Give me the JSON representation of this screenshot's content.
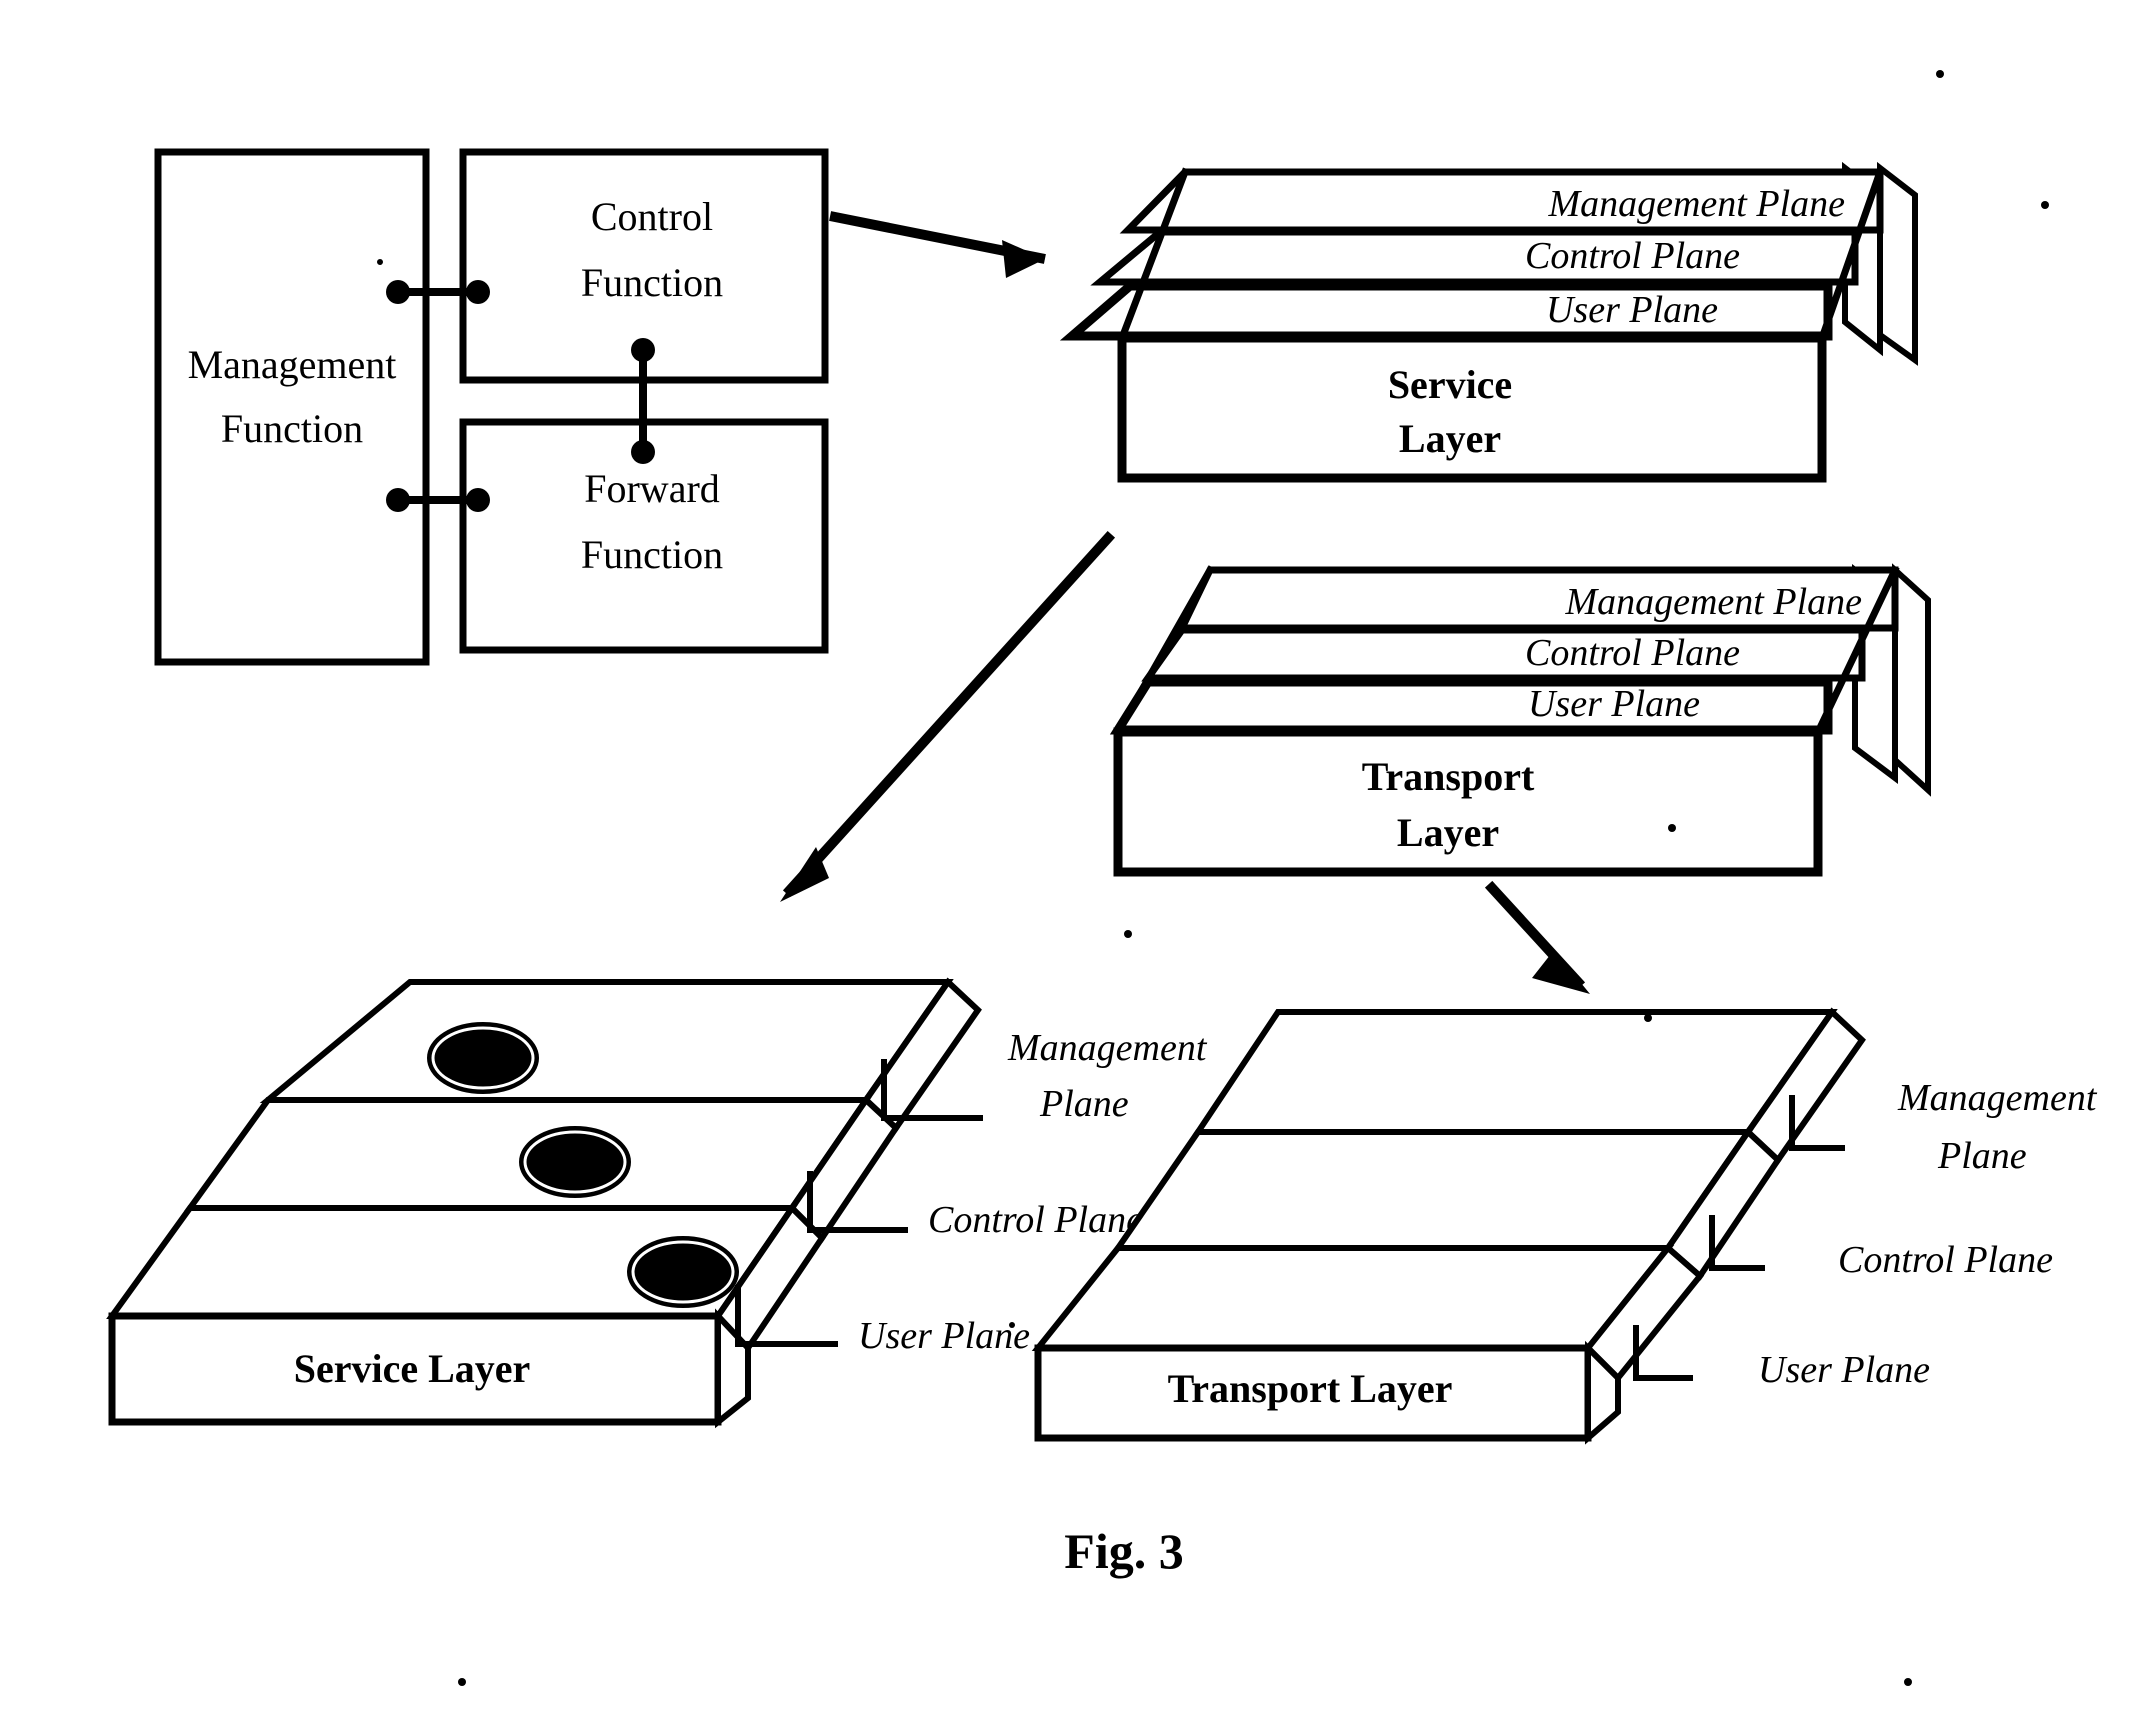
{
  "figure": {
    "caption": "Fig. 3",
    "blocks": {
      "management_function": "Management\nFunction",
      "management_function_line1": "Management",
      "management_function_line2": "Function",
      "control_function_line1": "Control",
      "control_function_line2": "Function",
      "forward_function_line1": "Forward",
      "forward_function_line2": "Function"
    },
    "service_stack": {
      "plane_labels": [
        "Management Plane",
        "Control Plane",
        "User Plane"
      ],
      "layer_label_line1": "Service",
      "layer_label_line2": "Layer"
    },
    "transport_stack": {
      "plane_labels": [
        "Management Plane",
        "Control Plane",
        "User Plane"
      ],
      "layer_label_line1": "Transport",
      "layer_label_line2": "Layer"
    },
    "service_slab": {
      "layer_label": "Service Layer",
      "callouts": [
        "Management",
        "Plane",
        "Control Plane",
        "User Plane"
      ],
      "callout_management_line1": "Management",
      "callout_management_line2": "Plane",
      "callout_control": "Control Plane",
      "callout_user": "User Plane",
      "node_count": 3
    },
    "transport_slab": {
      "layer_label": "Transport Layer",
      "callout_management_line1": "Management",
      "callout_management_line2": "Plane",
      "callout_control": "Control Plane",
      "callout_user": "User Plane"
    },
    "colors": {
      "ink": "#000000",
      "paper": "#ffffff"
    }
  }
}
